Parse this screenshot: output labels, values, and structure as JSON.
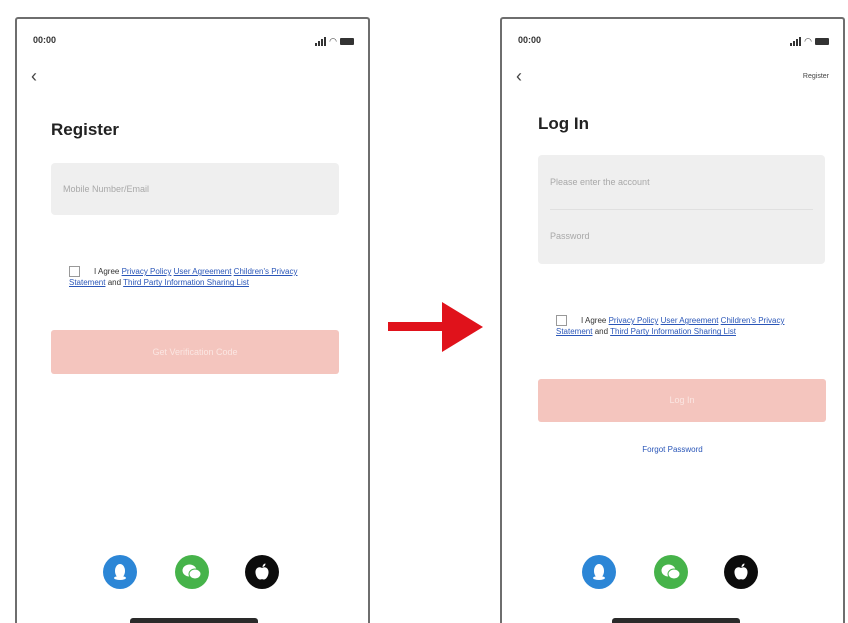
{
  "left_screen": {
    "status_time": "00:00",
    "back_glyph": "‹",
    "title": "Register",
    "mobile_placeholder": "Mobile Number/Email",
    "agree": {
      "prefix": "I Agree",
      "privacy_policy": "Privacy Policy",
      "user_agreement": "User Agreement",
      "children_privacy": "Children's Privacy Statement",
      "and": "and",
      "third_party": "Third Party Information Sharing List"
    },
    "primary_button": "Get Verification Code",
    "social_icons": [
      "qq-icon",
      "wechat-icon",
      "apple-icon"
    ]
  },
  "right_screen": {
    "status_time": "00:00",
    "back_glyph": "‹",
    "top_link": "Register",
    "title": "Log In",
    "account_placeholder": "Please enter the account",
    "password_placeholder": "Password",
    "agree": {
      "prefix": "I Agree",
      "privacy_policy": "Privacy Policy",
      "user_agreement": "User Agreement",
      "children_privacy": "Children's Privacy Statement",
      "and": "and",
      "third_party": "Third Party Information Sharing List"
    },
    "primary_button": "Log In",
    "forgot_password": "Forgot Password",
    "social_icons": [
      "qq-icon",
      "wechat-icon",
      "apple-icon"
    ]
  },
  "colors": {
    "primary_disabled": "#f4c5be",
    "link": "#2a56b8",
    "arrow": "#e0121b",
    "qq": "#2c86d6",
    "wechat": "#46b34a",
    "apple": "#0c0c0c"
  }
}
